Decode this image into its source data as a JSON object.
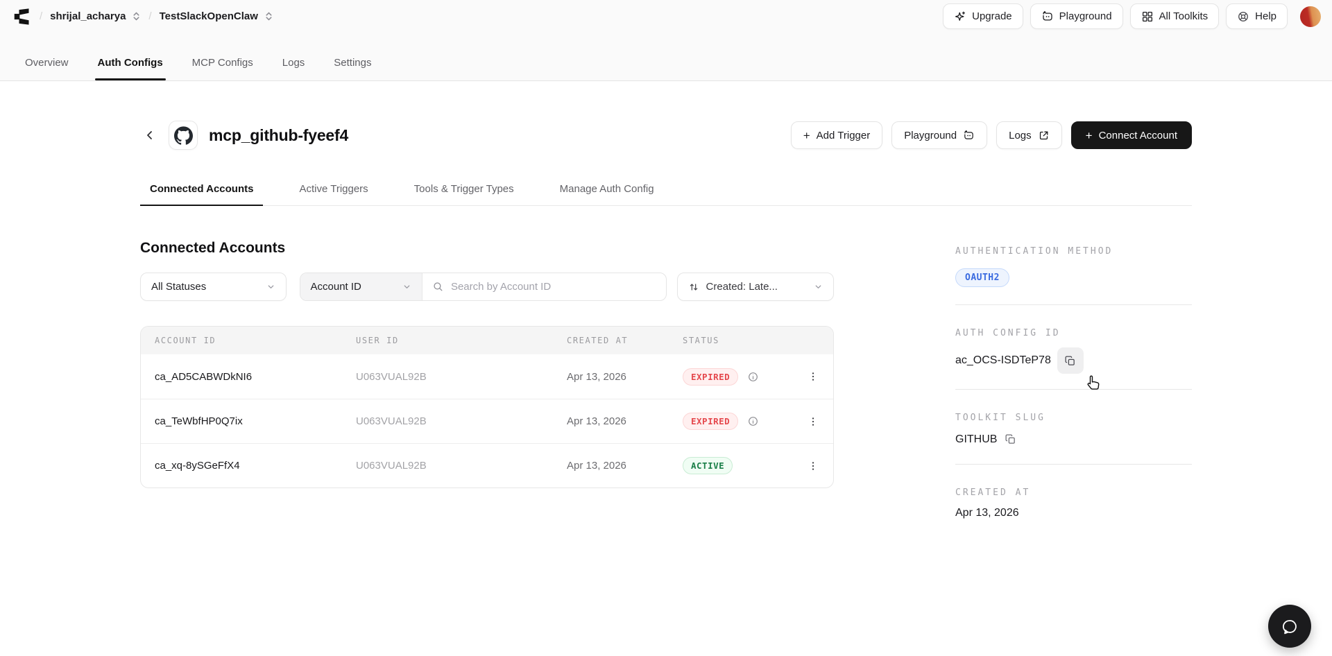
{
  "topbar": {
    "breadcrumb": {
      "separator": "/",
      "org": "shrijal_acharya",
      "project": "TestSlackOpenClaw"
    },
    "actions": [
      {
        "label": "Upgrade",
        "icon": "sparkle-icon"
      },
      {
        "label": "Playground",
        "icon": "playground-icon"
      },
      {
        "label": "All Toolkits",
        "icon": "grid-icon"
      },
      {
        "label": "Help",
        "icon": "lifebuoy-icon"
      }
    ]
  },
  "nav": {
    "items": [
      "Overview",
      "Auth Configs",
      "MCP Configs",
      "Logs",
      "Settings"
    ],
    "active": "Auth Configs"
  },
  "page": {
    "title": "mcp_github-fyeef4",
    "app_icon": "github-icon",
    "actions": {
      "add_trigger": "Add Trigger",
      "playground": "Playground",
      "logs": "Logs",
      "connect": "Connect Account",
      "plus": "+"
    },
    "tabs": [
      "Connected Accounts",
      "Active Triggers",
      "Tools & Trigger Types",
      "Manage Auth Config"
    ],
    "active_tab": "Connected Accounts"
  },
  "accounts": {
    "heading": "Connected Accounts",
    "filters": {
      "status": "All Statuses",
      "search_field": "Account ID",
      "search_placeholder": "Search by Account ID",
      "search_value": "",
      "sort": "Created: Late..."
    },
    "table": {
      "headers": [
        "ACCOUNT ID",
        "USER ID",
        "CREATED AT",
        "STATUS"
      ],
      "rows": [
        {
          "account_id": "ca_AD5CABWDkNI6",
          "user_id": "U063VUAL92B",
          "created_at": "Apr 13, 2026",
          "status": "EXPIRED"
        },
        {
          "account_id": "ca_TeWbfHP0Q7ix",
          "user_id": "U063VUAL92B",
          "created_at": "Apr 13, 2026",
          "status": "EXPIRED"
        },
        {
          "account_id": "ca_xq-8ySGeFfX4",
          "user_id": "U063VUAL92B",
          "created_at": "Apr 13, 2026",
          "status": "ACTIVE"
        }
      ]
    }
  },
  "sidebar": {
    "auth_method": {
      "label": "AUTHENTICATION METHOD",
      "value": "OAUTH2"
    },
    "auth_config_id": {
      "label": "AUTH CONFIG ID",
      "value": "ac_OCS-ISDTeP78"
    },
    "toolkit_slug": {
      "label": "TOOLKIT SLUG",
      "value": "GITHUB"
    },
    "created_at": {
      "label": "CREATED AT",
      "value": "Apr 13, 2026"
    }
  },
  "colors": {
    "topbar_bg": "#fafafa",
    "accent_dark": "#171717",
    "expired_red": "#e5484d",
    "active_green": "#1a7f48",
    "oauth_blue": "#3b6be0",
    "table_header_bg": "#f5f5f5"
  }
}
